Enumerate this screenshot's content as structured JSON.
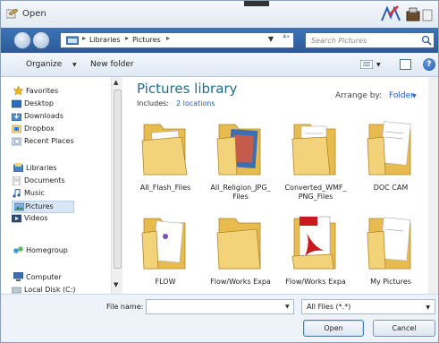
{
  "window": {
    "title": "Open"
  },
  "address": {
    "crumbs": [
      "Libraries",
      "Pictures"
    ],
    "separator": "▸",
    "dropdown_glyph": "▼",
    "refresh_glyph": "⁴ᐩ"
  },
  "search": {
    "placeholder": "Search Pictures"
  },
  "toolbar": {
    "organize_label": "Organize",
    "new_folder_label": "New folder",
    "help_label": "?",
    "dropdown_glyph": "▼"
  },
  "navpane": {
    "items": [
      {
        "label": "Favorites",
        "icon": "star-icon",
        "group": true
      },
      {
        "label": "Desktop",
        "icon": "desktop-icon"
      },
      {
        "label": "Downloads",
        "icon": "downloads-icon"
      },
      {
        "label": "Dropbox",
        "icon": "dropbox-icon"
      },
      {
        "label": "Recent Places",
        "icon": "recent-places-icon"
      },
      {
        "label": "Libraries",
        "icon": "libraries-icon",
        "group": true
      },
      {
        "label": "Documents",
        "icon": "documents-icon"
      },
      {
        "label": "Music",
        "icon": "music-icon"
      },
      {
        "label": "Pictures",
        "icon": "pictures-icon",
        "selected": true
      },
      {
        "label": "Videos",
        "icon": "videos-icon"
      },
      {
        "label": "Homegroup",
        "icon": "homegroup-icon",
        "group": true
      },
      {
        "label": "Computer",
        "icon": "computer-icon",
        "group": true
      },
      {
        "label": "Local Disk (C:)",
        "icon": "disk-icon"
      }
    ],
    "scroll_up_glyph": "▲",
    "scroll_down_glyph": "▼"
  },
  "library": {
    "title": "Pictures library",
    "includes_label": "Includes:",
    "includes_link": "2 locations",
    "arrange_label": "Arrange by:",
    "arrange_value": "Folder",
    "arrange_glyph": "▼"
  },
  "folders": [
    {
      "name": "All_Flash_Files",
      "icon": "folder-flash-icon"
    },
    {
      "name": "All_Religion_JPG_ Files",
      "icon": "folder-images-icon"
    },
    {
      "name": "Converted_WMF_ PNG_Files",
      "icon": "folder-documents-icon"
    },
    {
      "name": "DOC CAM",
      "icon": "folder-documents-icon"
    },
    {
      "name": "FLOW",
      "icon": "folder-flow-icon"
    },
    {
      "name": "Flow/Works Expa",
      "icon": "folder-empty-icon"
    },
    {
      "name": "Flow/Works Expa",
      "icon": "folder-pdf-icon"
    },
    {
      "name": "My Pictures",
      "icon": "folder-documents-icon"
    }
  ],
  "footer": {
    "filename_label": "File name:",
    "filename_value": "",
    "filetype_value": "All Files (*.*)",
    "dropdown_glyph": "▼",
    "open_label": "Open",
    "cancel_label": "Cancel"
  },
  "colors": {
    "accent": "#1e6f8e",
    "link": "#1f5fb4",
    "navbar": "#2b5a97",
    "folder": "#f3d37a"
  }
}
